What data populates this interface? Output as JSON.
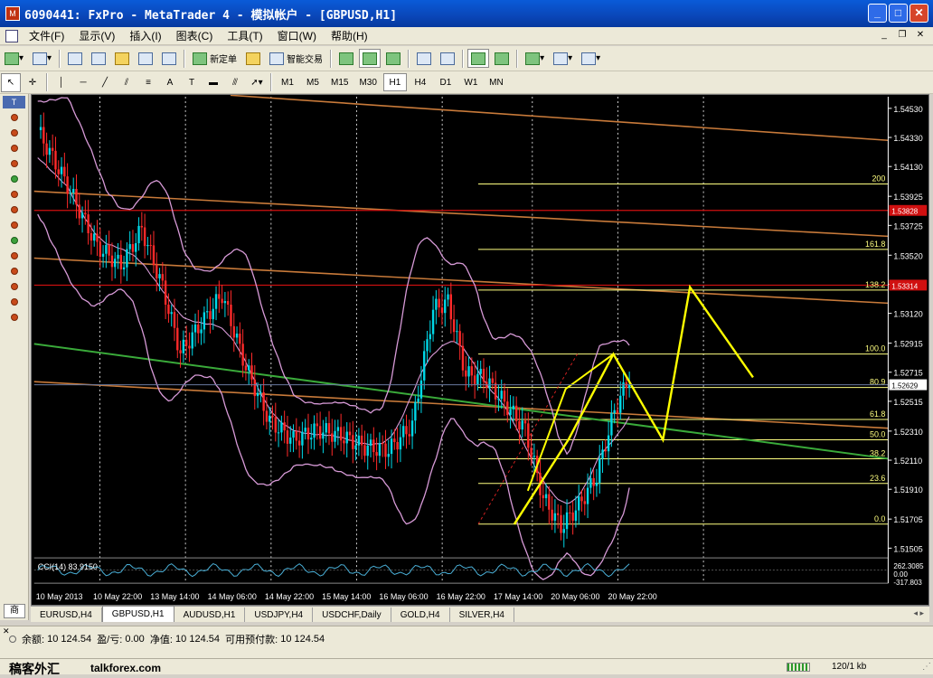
{
  "window": {
    "title": "6090441: FxPro - MetaTrader 4 - 模拟帐户 - [GBPUSD,H1]",
    "min": "_",
    "max": "□",
    "close": "✕"
  },
  "menu": {
    "items": [
      "文件(F)",
      "显示(V)",
      "插入(I)",
      "图表(C)",
      "工具(T)",
      "窗口(W)",
      "帮助(H)"
    ]
  },
  "toolbar": {
    "new_order": "新定单",
    "expert_trading": "智能交易"
  },
  "timeframes": [
    "M1",
    "M5",
    "M15",
    "M30",
    "H1",
    "H4",
    "D1",
    "W1",
    "MN"
  ],
  "active_timeframe": "H1",
  "side_panel": {
    "header": "T",
    "bottom": "商"
  },
  "chart_data": {
    "type": "candlestick",
    "symbol": "GBPUSD",
    "timeframe": "H1",
    "price_levels": [
      "1.54530",
      "1.54330",
      "1.54130",
      "1.53925",
      "1.53725",
      "1.53520",
      "1.53320",
      "1.53120",
      "1.52915",
      "1.52715",
      "1.52515",
      "1.52310",
      "1.52110",
      "1.51910",
      "1.51705",
      "1.51505"
    ],
    "ylim": [
      1.5145,
      1.5461
    ],
    "time_labels": [
      "10 May 2013",
      "10 May 22:00",
      "13 May 14:00",
      "14 May 06:00",
      "14 May 22:00",
      "15 May 14:00",
      "16 May 06:00",
      "16 May 22:00",
      "17 May 14:00",
      "20 May 06:00",
      "20 May 22:00"
    ],
    "current_price": "1.52629",
    "red_line_labels": [
      "1.53828",
      "1.53314"
    ],
    "fibonacci": [
      {
        "level": "200",
        "price": 1.5401
      },
      {
        "level": "161.8",
        "price": 1.5356
      },
      {
        "level": "138.2",
        "price": 1.5328
      },
      {
        "level": "100.0",
        "price": 1.5284
      },
      {
        "level": "80.9",
        "price": 1.5261
      },
      {
        "level": "61.8",
        "price": 1.5239
      },
      {
        "level": "50.0",
        "price": 1.5225
      },
      {
        "level": "38.2",
        "price": 1.5212
      },
      {
        "level": "23.6",
        "price": 1.5195
      },
      {
        "level": "0.0",
        "price": 1.5167
      }
    ],
    "cci": {
      "label": "CCI(14) 83.9150",
      "levels": [
        "262.3085",
        "0.00",
        "-317.803"
      ]
    },
    "colors": {
      "background": "#000000",
      "bull_candle": "#00d8e8",
      "bear_candle": "#ff2a2a",
      "bollinger": "#d79ad7",
      "channel": "#c87a3a",
      "trendline": "#3aaa3a",
      "fibonacci": "#ffff80",
      "projection": "#ffff00",
      "grid": "#ffffff"
    }
  },
  "tabs": [
    "EURUSD,H4",
    "GBPUSD,H1",
    "AUDUSD,H1",
    "USDJPY,H4",
    "USDCHF,Daily",
    "GOLD,H4",
    "SILVER,H4"
  ],
  "active_tab": "GBPUSD,H1",
  "account": {
    "balance_label": "余额:",
    "balance": "10 124.54",
    "pl_label": "盈/亏:",
    "pl": "0.00",
    "equity_label": "净值:",
    "equity": "10 124.54",
    "free_margin_label": "可用预付款:",
    "free_margin": "10 124.54"
  },
  "status": {
    "watermark": "稿客外汇",
    "watermark_site": "talkforex.com",
    "connection": "120/1 kb"
  }
}
